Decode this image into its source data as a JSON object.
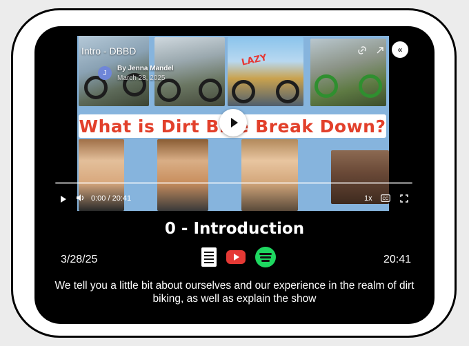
{
  "video": {
    "title": "Intro - DBBD",
    "author_initial": "J",
    "author_name": "By Jenna Mandel",
    "author_date": "March 28, 2025",
    "banner_text": "What is Dirt Bike Break Down?",
    "lazy_sign": "LAZY",
    "time_display": "0:00 / 20:41",
    "speed": "1x",
    "icons": {
      "link": "link-icon",
      "share": "share-icon",
      "collapse": "chevrons-left-icon",
      "play": "play-icon",
      "volume": "volume-icon",
      "captions": "captions-icon",
      "fullscreen": "fullscreen-icon"
    }
  },
  "episode": {
    "title": "0 - Introduction",
    "date": "3/28/25",
    "duration": "20:41",
    "description": "We tell you a little bit about ourselves and our experience in the realm of dirt biking, as well as explain the show",
    "links": [
      {
        "name": "transcript-doc-icon",
        "color": "#ffffff"
      },
      {
        "name": "youtube-icon",
        "color": "#e53935"
      },
      {
        "name": "spotify-icon",
        "color": "#1ed760"
      }
    ]
  }
}
